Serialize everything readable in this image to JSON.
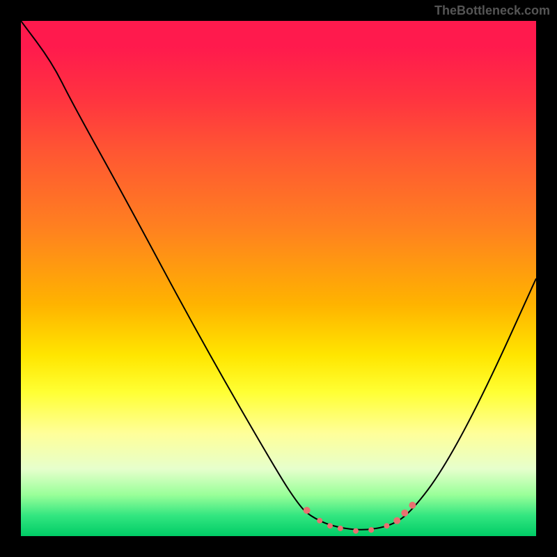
{
  "watermark": "TheBottleneck.com",
  "chart_data": {
    "type": "line",
    "title": "",
    "xlabel": "",
    "ylabel": "",
    "xlim": [
      0,
      100
    ],
    "ylim": [
      0,
      100
    ],
    "series": [
      {
        "name": "curve",
        "points": [
          {
            "x": 0,
            "y": 100
          },
          {
            "x": 6,
            "y": 92
          },
          {
            "x": 10,
            "y": 84
          },
          {
            "x": 20,
            "y": 66
          },
          {
            "x": 35,
            "y": 38
          },
          {
            "x": 50,
            "y": 12
          },
          {
            "x": 54,
            "y": 6
          },
          {
            "x": 56,
            "y": 4
          },
          {
            "x": 60,
            "y": 2
          },
          {
            "x": 66,
            "y": 1
          },
          {
            "x": 72,
            "y": 2
          },
          {
            "x": 76,
            "y": 5
          },
          {
            "x": 82,
            "y": 13
          },
          {
            "x": 90,
            "y": 28
          },
          {
            "x": 100,
            "y": 50
          }
        ]
      }
    ],
    "markers": [
      {
        "x": 55.5,
        "y": 5,
        "r": 5
      },
      {
        "x": 58,
        "y": 3,
        "r": 4
      },
      {
        "x": 60,
        "y": 2,
        "r": 4
      },
      {
        "x": 62,
        "y": 1.5,
        "r": 4
      },
      {
        "x": 65,
        "y": 1,
        "r": 4
      },
      {
        "x": 68,
        "y": 1.2,
        "r": 4
      },
      {
        "x": 71,
        "y": 2,
        "r": 4
      },
      {
        "x": 73,
        "y": 3,
        "r": 5
      },
      {
        "x": 74.5,
        "y": 4.5,
        "r": 5
      },
      {
        "x": 76,
        "y": 6,
        "r": 5
      }
    ],
    "marker_color": "#e87070",
    "curve_color": "#000000"
  }
}
